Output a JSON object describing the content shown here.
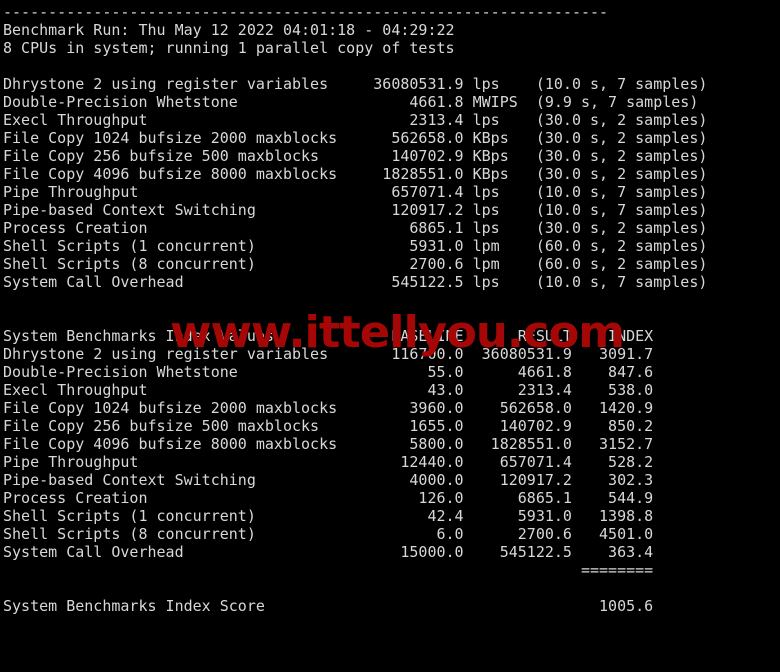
{
  "terminal": {
    "background_color": "#000000",
    "text_color": "#d8d8d8",
    "watermark_color": "#a50707",
    "watermark_text": "www.ittellyou.com",
    "separator_line": "-------------------------------------------------------------------",
    "header": {
      "benchmark_run": "Benchmark Run: Thu May 12 2022 04:01:18 - 04:29:22",
      "cpu_info": "8 CPUs in system; running 1 parallel copy of tests"
    },
    "results": {
      "rows": [
        {
          "name": "Dhrystone 2 using register variables",
          "value": "36080531.9",
          "unit": "lps",
          "timing": "(10.0 s, 7 samples)"
        },
        {
          "name": "Double-Precision Whetstone",
          "value": "4661.8",
          "unit": "MWIPS",
          "timing": "(9.9 s, 7 samples)"
        },
        {
          "name": "Execl Throughput",
          "value": "2313.4",
          "unit": "lps",
          "timing": "(30.0 s, 2 samples)"
        },
        {
          "name": "File Copy 1024 bufsize 2000 maxblocks",
          "value": "562658.0",
          "unit": "KBps",
          "timing": "(30.0 s, 2 samples)"
        },
        {
          "name": "File Copy 256 bufsize 500 maxblocks",
          "value": "140702.9",
          "unit": "KBps",
          "timing": "(30.0 s, 2 samples)"
        },
        {
          "name": "File Copy 4096 bufsize 8000 maxblocks",
          "value": "1828551.0",
          "unit": "KBps",
          "timing": "(30.0 s, 2 samples)"
        },
        {
          "name": "Pipe Throughput",
          "value": "657071.4",
          "unit": "lps",
          "timing": "(10.0 s, 7 samples)"
        },
        {
          "name": "Pipe-based Context Switching",
          "value": "120917.2",
          "unit": "lps",
          "timing": "(10.0 s, 7 samples)"
        },
        {
          "name": "Process Creation",
          "value": "6865.1",
          "unit": "lps",
          "timing": "(30.0 s, 2 samples)"
        },
        {
          "name": "Shell Scripts (1 concurrent)",
          "value": "5931.0",
          "unit": "lpm",
          "timing": "(60.0 s, 2 samples)"
        },
        {
          "name": "Shell Scripts (8 concurrent)",
          "value": "2700.6",
          "unit": "lpm",
          "timing": "(60.0 s, 2 samples)"
        },
        {
          "name": "System Call Overhead",
          "value": "545122.5",
          "unit": "lps",
          "timing": "(10.0 s, 7 samples)"
        }
      ]
    },
    "index_table": {
      "title": "System Benchmarks Index Values",
      "columns": [
        "BASELINE",
        "RESULT",
        "INDEX"
      ],
      "rows": [
        {
          "name": "Dhrystone 2 using register variables",
          "baseline": "116700.0",
          "result": "36080531.9",
          "index": "3091.7"
        },
        {
          "name": "Double-Precision Whetstone",
          "baseline": "55.0",
          "result": "4661.8",
          "index": "847.6"
        },
        {
          "name": "Execl Throughput",
          "baseline": "43.0",
          "result": "2313.4",
          "index": "538.0"
        },
        {
          "name": "File Copy 1024 bufsize 2000 maxblocks",
          "baseline": "3960.0",
          "result": "562658.0",
          "index": "1420.9"
        },
        {
          "name": "File Copy 256 bufsize 500 maxblocks",
          "baseline": "1655.0",
          "result": "140702.9",
          "index": "850.2"
        },
        {
          "name": "File Copy 4096 bufsize 8000 maxblocks",
          "baseline": "5800.0",
          "result": "1828551.0",
          "index": "3152.7"
        },
        {
          "name": "Pipe Throughput",
          "baseline": "12440.0",
          "result": "657071.4",
          "index": "528.2"
        },
        {
          "name": "Pipe-based Context Switching",
          "baseline": "4000.0",
          "result": "120917.2",
          "index": "302.3"
        },
        {
          "name": "Process Creation",
          "baseline": "126.0",
          "result": "6865.1",
          "index": "544.9"
        },
        {
          "name": "Shell Scripts (1 concurrent)",
          "baseline": "42.4",
          "result": "5931.0",
          "index": "1398.8"
        },
        {
          "name": "Shell Scripts (8 concurrent)",
          "baseline": "6.0",
          "result": "2700.6",
          "index": "4501.0"
        },
        {
          "name": "System Call Overhead",
          "baseline": "15000.0",
          "result": "545122.5",
          "index": "363.4"
        }
      ],
      "score_rule": "========",
      "score_label": "System Benchmarks Index Score",
      "score_value": "1005.6"
    }
  }
}
